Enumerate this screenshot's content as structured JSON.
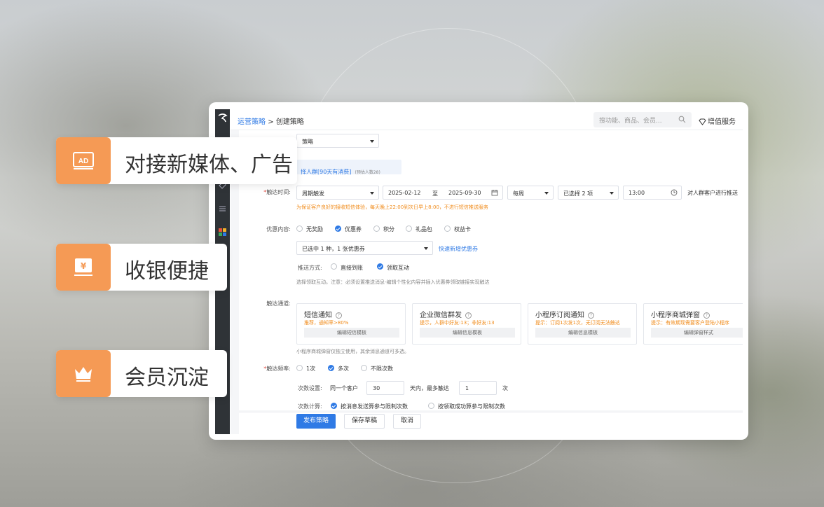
{
  "breadcrumb": {
    "parent": "运营策略",
    "separator": ">",
    "current": "创建策略"
  },
  "search": {
    "placeholder": "搜功能、商品、会员..."
  },
  "value_added_service": "增值服务",
  "form": {
    "strategy_type_value": "策略",
    "crowd_tag": "择人群[90天有消费]",
    "crowd_tag_note": "(预估人数28)",
    "trigger_time": {
      "label": "触达时间:",
      "mode": "周期触发",
      "start_date": "2025-02-12",
      "to": "至",
      "end_date": "2025-09-30",
      "frequency": "每周",
      "days_selected": "已选择 2 项",
      "time": "13:00",
      "suffix": "对人群客户进行推送",
      "notice": "为保证客户良好的接收短信体验，每天晚上22:00到次日早上8:00，不进行短信推送服务"
    },
    "offer": {
      "label": "优惠内容:",
      "options": [
        "无奖励",
        "优惠券",
        "积分",
        "礼品包",
        "权益卡"
      ],
      "selected_index": 1,
      "coupon_select": "已选中 1 种，1 张优惠券",
      "quick_add": "快速新增优惠券",
      "push_label": "推送方式:",
      "push_options": [
        "直接到账",
        "领取互动"
      ],
      "push_selected_index": 1,
      "push_note": "选择领取互动。注意：必须设置推送消息-编辑个性化内容并插入优惠券领取链接实现触达"
    },
    "channels": {
      "label": "触达通道:",
      "items": [
        {
          "title": "短信通知",
          "note": "推荐，通知率>80%",
          "button": "编辑短信模板"
        },
        {
          "title": "企业微信群发",
          "note": "提示，人群中好友:13；非好友:13",
          "button": "编辑信息模板"
        },
        {
          "title": "小程序订阅通知",
          "note": "提示：订阅1次发1次，无订阅无法触达",
          "button": "编辑信息模板"
        },
        {
          "title": "小程序商城弹窗",
          "note": "提示：有效期现需要客户登陆小程序",
          "button": "编辑弹窗样式"
        }
      ],
      "footnote": "小程序商城弹窗仅独立使用，其余消息通道可多选。"
    },
    "frequency": {
      "label": "触达频率:",
      "options": [
        "1次",
        "多次",
        "不限次数"
      ],
      "selected_index": 1,
      "count_label": "次数设置:",
      "same_customer": "同一个客户",
      "days_value": "30",
      "days_unit": "天内，最多触达",
      "times_value": "1",
      "times_unit": "次",
      "calc_label": "次数计算:",
      "calc_options": [
        "按消息发送算参与限制次数",
        "按领取成功算参与限制次数"
      ],
      "calc_selected_index": 0
    }
  },
  "footer": {
    "publish": "发布策略",
    "save_draft": "保存草稿",
    "cancel": "取消"
  },
  "features": [
    {
      "icon": "ad-icon",
      "label": "对接新媒体、广告"
    },
    {
      "icon": "cashier-icon",
      "label": "收银便捷"
    },
    {
      "icon": "crown-icon",
      "label": "会员沉淀"
    }
  ],
  "colors": {
    "accent": "#2f7ae5",
    "orange": "#f59a55",
    "warning": "#f08b1a"
  }
}
